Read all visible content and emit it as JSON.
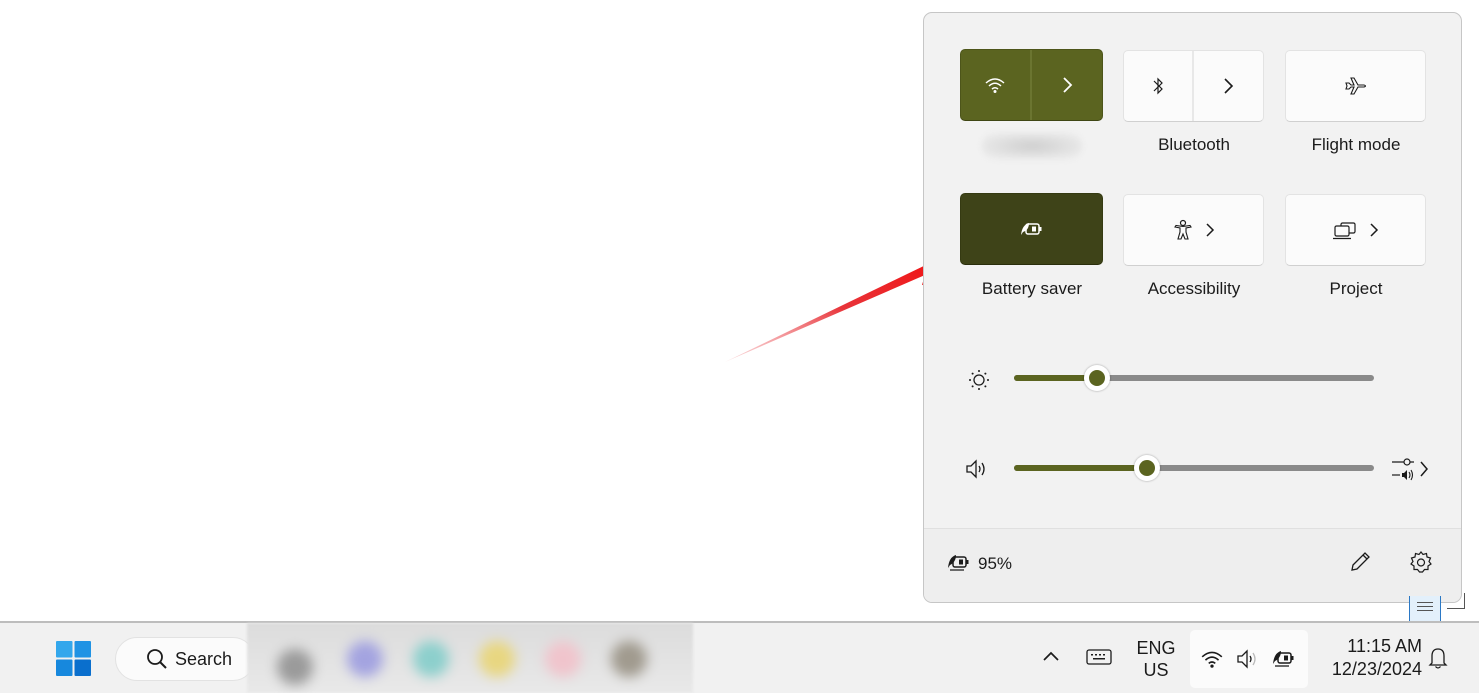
{
  "quick_settings": {
    "tiles": [
      {
        "id": "wifi",
        "label": "",
        "label_blurred": true,
        "icon": "wifi-icon",
        "has_chevron": true,
        "state": "on"
      },
      {
        "id": "bluetooth",
        "label": "Bluetooth",
        "icon": "bluetooth-icon",
        "has_chevron": true,
        "state": "off"
      },
      {
        "id": "flight-mode",
        "label": "Flight mode",
        "icon": "airplane-icon",
        "has_chevron": false,
        "state": "off"
      },
      {
        "id": "battery-saver",
        "label": "Battery saver",
        "icon": "battery-saver-icon",
        "has_chevron": false,
        "state": "on"
      },
      {
        "id": "accessibility",
        "label": "Accessibility",
        "icon": "accessibility-icon",
        "has_chevron": true,
        "state": "off"
      },
      {
        "id": "project",
        "label": "Project",
        "icon": "project-icon",
        "has_chevron": true,
        "state": "off"
      }
    ],
    "brightness": {
      "icon": "sun-icon",
      "value_percent": 23
    },
    "volume": {
      "icon": "speaker-icon",
      "value_percent": 37,
      "mixer_icon": "volume-mixer-icon"
    },
    "footer": {
      "battery_icon": "battery-saver-icon",
      "battery_percent": "95%",
      "edit_icon": "pencil-icon",
      "settings_icon": "gear-icon"
    },
    "accent_color": "#5b6420",
    "battery_saver_color": "#3e4318"
  },
  "annotation": {
    "type": "arrow",
    "color": "#e8101a",
    "points_to": "battery-saver tile"
  },
  "taskbar": {
    "search_label": "Search",
    "start_icon": "windows-logo-icon",
    "pinned_apps_blurred": true,
    "tray": {
      "overflow_icon": "chevron-up-icon",
      "keyboard_icon": "keyboard-icon",
      "language_line1": "ENG",
      "language_line2": "US",
      "status_icons": [
        "wifi-icon",
        "speaker-icon",
        "battery-saver-icon"
      ],
      "time": "11:15 AM",
      "date": "12/23/2024",
      "notification_icon": "bell-icon"
    }
  }
}
